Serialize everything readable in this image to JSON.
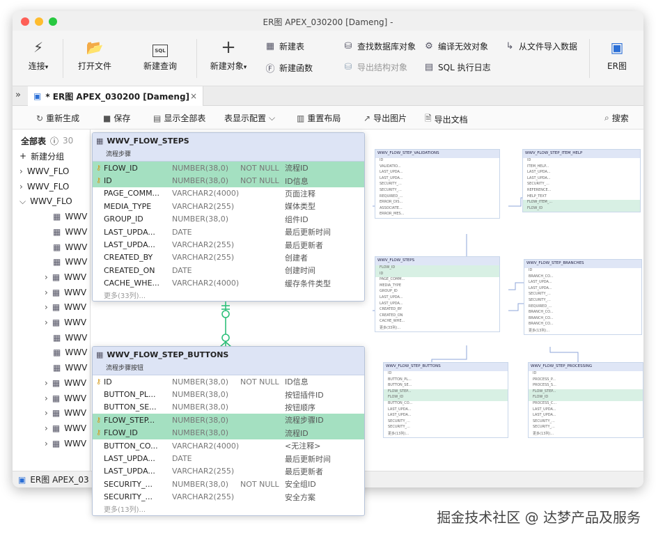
{
  "window": {
    "title": "ER图 APEX_030200 [Dameng]",
    "title_suffix": "-"
  },
  "toolbar": {
    "connect": "连接",
    "open_file": "打开文件",
    "new_query": "新建查询",
    "new_object": "新建对象",
    "new_table": "新建表",
    "new_function": "新建函数",
    "find_db_object": "查找数据库对象",
    "export_structure": "导出结构对象",
    "compile_invalid": "编译无效对象",
    "sql_log": "SQL 执行日志",
    "import_from_file": "从文件导入数据",
    "er_diagram": "ER图"
  },
  "tab": {
    "label": "* ER图 APEX_030200 [Dameng]",
    "close": "×"
  },
  "er_toolbar": {
    "regenerate": "重新生成",
    "save": "保存",
    "show_all_tables": "显示全部表",
    "table_display_config": "表显示配置",
    "relayout": "重置布局",
    "export_image": "导出图片",
    "export_doc": "导出文档",
    "search": "搜索"
  },
  "sidebar": {
    "all_tables": "全部表",
    "count": "30",
    "new_group": "新建分组",
    "groups": [
      "WWV_FLO",
      "WWV_FLO",
      "WWV_FLO"
    ],
    "tables": [
      "WWV",
      "WWV",
      "WWV",
      "WWV",
      "WWV",
      "WWV",
      "WWV",
      "WWV",
      "WWV",
      "WWV",
      "WWV",
      "WWV",
      "WWV",
      "WWV",
      "WWV",
      "WWV"
    ]
  },
  "status": {
    "label": "ER图 APEX_03"
  },
  "card_steps": {
    "name": "WWV_FLOW_STEPS",
    "comment": "流程步骤",
    "rows": [
      {
        "name": "FLOW_ID",
        "type": "NUMBER(38,0)",
        "null": "NOT NULL",
        "comment": "流程ID",
        "key": true,
        "hl": true
      },
      {
        "name": "ID",
        "type": "NUMBER(38,0)",
        "null": "NOT NULL",
        "comment": "ID信息",
        "key": true,
        "hl": true
      },
      {
        "name": "PAGE_COMM...",
        "type": "VARCHAR2(4000)",
        "null": "",
        "comment": "页面注释",
        "key": false,
        "hl": false
      },
      {
        "name": "MEDIA_TYPE",
        "type": "VARCHAR2(255)",
        "null": "",
        "comment": "媒体类型",
        "key": false,
        "hl": false
      },
      {
        "name": "GROUP_ID",
        "type": "NUMBER(38,0)",
        "null": "",
        "comment": "组件ID",
        "key": false,
        "hl": false
      },
      {
        "name": "LAST_UPDA...",
        "type": "DATE",
        "null": "",
        "comment": "最后更新时间",
        "key": false,
        "hl": false
      },
      {
        "name": "LAST_UPDA...",
        "type": "VARCHAR2(255)",
        "null": "",
        "comment": "最后更新者",
        "key": false,
        "hl": false
      },
      {
        "name": "CREATED_BY",
        "type": "VARCHAR2(255)",
        "null": "",
        "comment": "创建者",
        "key": false,
        "hl": false
      },
      {
        "name": "CREATED_ON",
        "type": "DATE",
        "null": "",
        "comment": "创建时间",
        "key": false,
        "hl": false
      },
      {
        "name": "CACHE_WHE...",
        "type": "VARCHAR2(4000)",
        "null": "",
        "comment": "缓存条件类型",
        "key": false,
        "hl": false
      }
    ],
    "more": "更多(33列)..."
  },
  "card_buttons": {
    "name": "WWV_FLOW_STEP_BUTTONS",
    "comment": "流程步骤按钮",
    "rows": [
      {
        "name": "ID",
        "type": "NUMBER(38,0)",
        "null": "NOT NULL",
        "comment": "ID信息",
        "key": true,
        "hl": false
      },
      {
        "name": "BUTTON_PL...",
        "type": "NUMBER(38,0)",
        "null": "",
        "comment": "按钮插件ID",
        "key": false,
        "hl": false
      },
      {
        "name": "BUTTON_SE...",
        "type": "NUMBER(38,0)",
        "null": "",
        "comment": "按钮顺序",
        "key": false,
        "hl": false
      },
      {
        "name": "FLOW_STEP...",
        "type": "NUMBER(38,0)",
        "null": "",
        "comment": "流程步骤ID",
        "key": true,
        "hl": true
      },
      {
        "name": "FLOW_ID",
        "type": "NUMBER(38,0)",
        "null": "",
        "comment": "流程ID",
        "key": true,
        "hl": true
      },
      {
        "name": "BUTTON_CO...",
        "type": "VARCHAR2(4000)",
        "null": "",
        "comment": "<无注释>",
        "key": false,
        "hl": false
      },
      {
        "name": "LAST_UPDA...",
        "type": "DATE",
        "null": "",
        "comment": "最后更新时间",
        "key": false,
        "hl": false
      },
      {
        "name": "LAST_UPDA...",
        "type": "VARCHAR2(255)",
        "null": "",
        "comment": "最后更新者",
        "key": false,
        "hl": false
      },
      {
        "name": "SECURITY_...",
        "type": "NUMBER(38,0)",
        "null": "NOT NULL",
        "comment": "安全组ID",
        "key": false,
        "hl": false
      },
      {
        "name": "SECURITY_...",
        "type": "VARCHAR2(255)",
        "null": "",
        "comment": "安全方案",
        "key": false,
        "hl": false
      }
    ],
    "more": "更多(13列)..."
  },
  "minis": [
    {
      "name": "WWV_FLOW_STEP_VALIDATIONS",
      "rows": [
        "ID",
        "VALIDATIO...",
        "LAST_UPDA...",
        "LAST_UPDA...",
        "SECURITY_...",
        "SECURITY_...",
        "REQUIRED_...",
        "ERROR_DIS...",
        "ASSOCIATE...",
        "ERROR_MES..."
      ]
    },
    {
      "name": "WWV_FLOW_STEP_ITEM_HELP",
      "rows": [
        "ID",
        "ITEM_HELP...",
        "LAST_UPDA...",
        "LAST_UPDA...",
        "SECURITY_...",
        "REFERENCE...",
        "HELP_TEXT",
        "FLOW_ITEM_...",
        "FLOW_ID"
      ]
    },
    {
      "name": "WWV_FLOW_STEPS",
      "rows": [
        "FLOW_ID",
        "ID",
        "PAGE_COMM...",
        "MEDIA_TYPE",
        "GROUP_ID",
        "LAST_UPDA...",
        "LAST_UPDA...",
        "CREATED_BY",
        "CREATED_ON",
        "CACHE_WHE...",
        "更多(33列)..."
      ]
    },
    {
      "name": "WWV_FLOW_STEP_BRANCHES",
      "rows": [
        "ID",
        "BRANCH_CO...",
        "LAST_UPDA...",
        "LAST_UPDA...",
        "SECURITY_...",
        "SECURITY_...",
        "REQUIRED_...",
        "BRANCH_CO...",
        "BRANCH_CO...",
        "BRANCH_CO...",
        "更多(13列)..."
      ]
    },
    {
      "name": "WWV_FLOW_STEP_BUTTONS",
      "rows": [
        "ID",
        "BUTTON_PL...",
        "BUTTON_SE...",
        "FLOW_STEP...",
        "FLOW_ID",
        "BUTTON_CO...",
        "LAST_UPDA...",
        "LAST_UPDA...",
        "SECURITY_...",
        "SECURITY_...",
        "更多(13列)..."
      ]
    },
    {
      "name": "WWV_FLOW_STEP_PROCESSING",
      "rows": [
        "ID",
        "PROCESS_P...",
        "PROCESS_S...",
        "FLOW_STEP...",
        "FLOW_ID",
        "PROCESS_C...",
        "LAST_UPDA...",
        "LAST_UPDA...",
        "SECURITY_...",
        "SECURITY_...",
        "更多(13列)..."
      ]
    }
  ],
  "watermark": "掘金技术社区 @ 达梦产品及服务",
  "colors": {
    "accent": "#2b6fd6",
    "highlight": "#a4e0c1",
    "header": "#dde4f5",
    "connector": "#2ec07a"
  }
}
